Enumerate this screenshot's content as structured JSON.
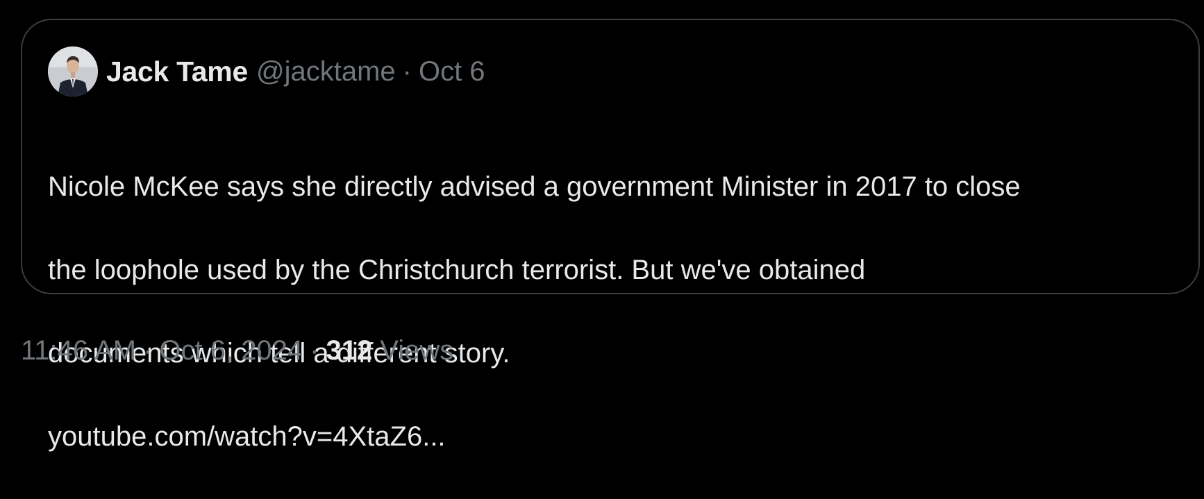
{
  "quoted_tweet": {
    "author_name": "Jack Tame",
    "handle": "@jacktame",
    "date": "Oct 6",
    "text_line_1": "Nicole McKee says she directly advised a government Minister in 2017 to close",
    "text_line_2": "the loophole used by the Christchurch terrorist. But we've obtained",
    "text_line_3": "documents which tell a different story.",
    "link": "youtube.com/watch?v=4XtaZ6..."
  },
  "tweet_meta": {
    "time": "11:46 AM",
    "date": "Oct 6, 2024",
    "views_count": "312",
    "views_label": "Views",
    "separator": "·"
  },
  "colors": {
    "background": "#000000",
    "primary_text": "#e7e9ea",
    "secondary_text": "#71767b",
    "card_border": "#3a3d41"
  },
  "icons": {
    "avatar": "profile-photo"
  }
}
